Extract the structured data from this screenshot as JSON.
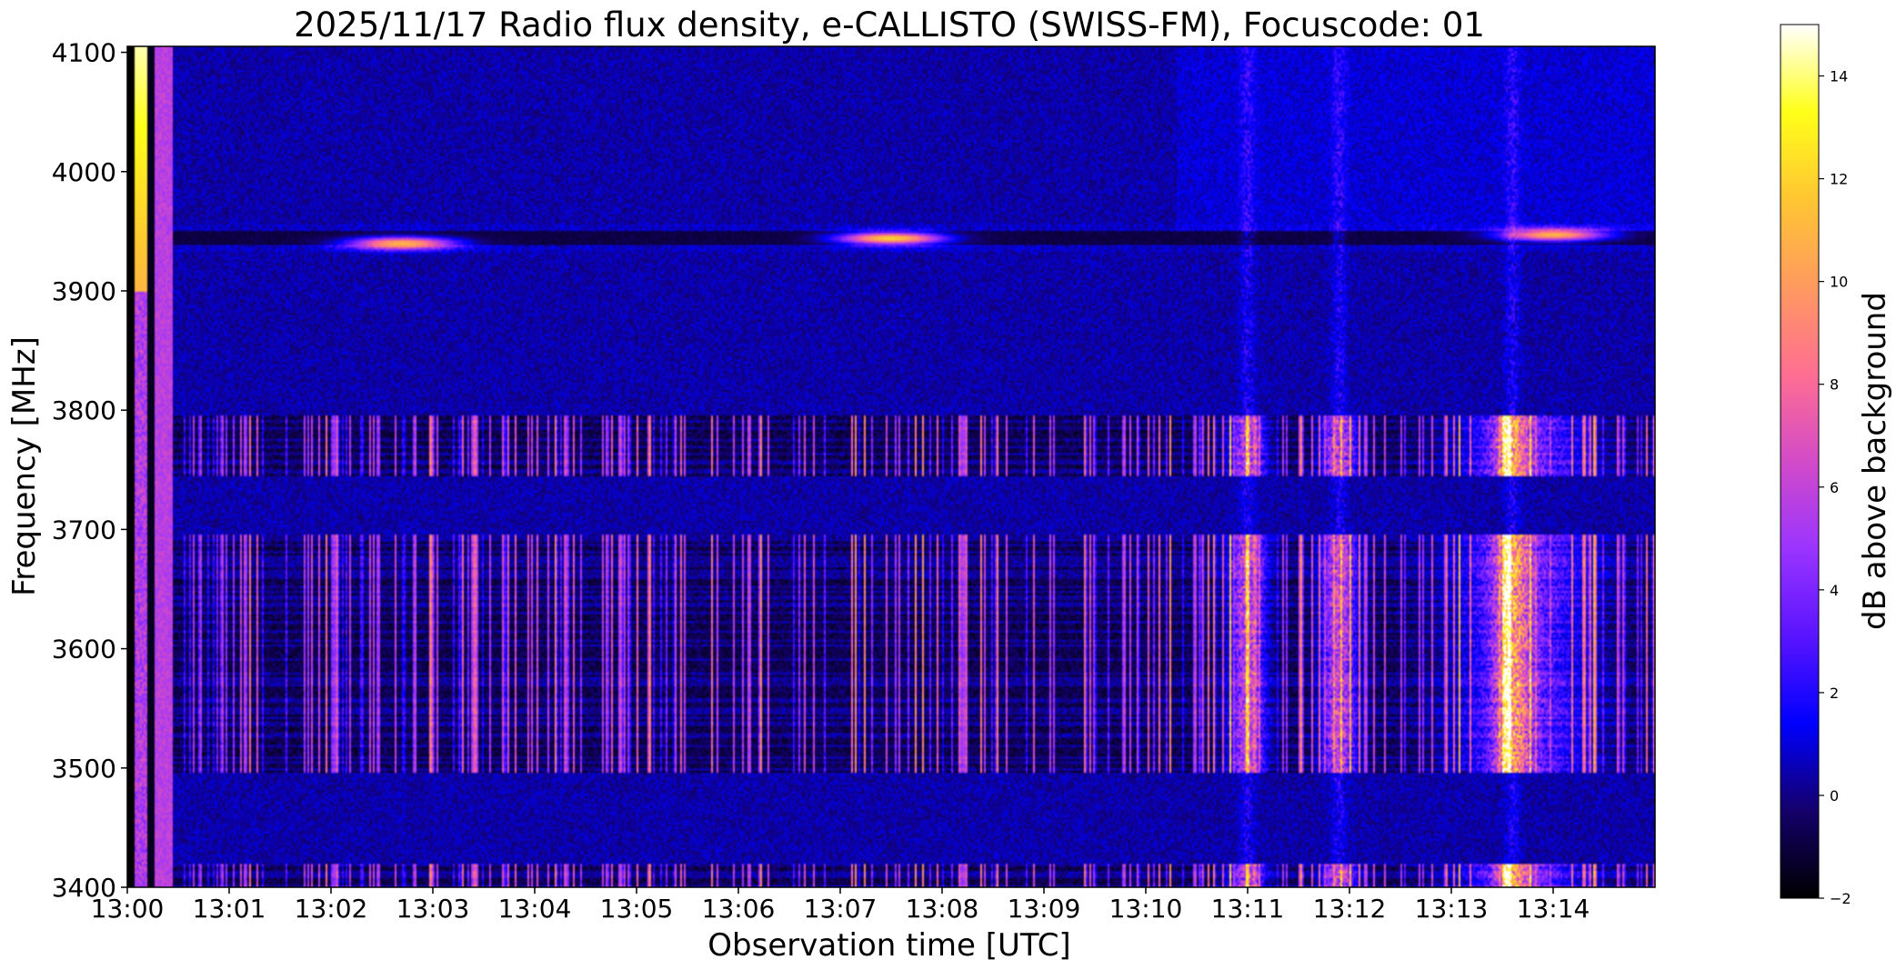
{
  "chart_data": {
    "type": "heatmap",
    "title": "2025/11/17  Radio flux density, e-CALLISTO (SWISS-FM), Focuscode: 01",
    "xlabel": "Observation time [UTC]",
    "ylabel": "Frequency [MHz]",
    "colorbar_label": "dB above background",
    "x_ticks": [
      "13:00",
      "13:01",
      "13:02",
      "13:03",
      "13:04",
      "13:05",
      "13:06",
      "13:07",
      "13:08",
      "13:09",
      "13:10",
      "13:11",
      "13:12",
      "13:13",
      "13:14"
    ],
    "xlim_minutes_after_1300": [
      0,
      15
    ],
    "ylim": [
      3400,
      4105
    ],
    "y_ticks": [
      3400,
      3500,
      3600,
      3700,
      3800,
      3900,
      4000,
      4100
    ],
    "colorbar_ticks": [
      -2,
      0,
      2,
      4,
      6,
      8,
      10,
      12,
      14
    ],
    "colorbar_range": [
      -2,
      15
    ],
    "colormap": "gnuplot2",
    "colormap_stops": [
      "#000000",
      "#14006a",
      "#0000ff",
      "#5a14ff",
      "#9a34ff",
      "#d24bc8",
      "#ff6e91",
      "#ff9a5f",
      "#ffc632",
      "#ffff19",
      "#ffffff"
    ],
    "features": {
      "background_level_db": 0.4,
      "horizontal_line_mhz": 3945,
      "bright_spots": [
        {
          "minute": 2.7,
          "freq_mhz": 3940,
          "db": 12
        },
        {
          "minute": 7.5,
          "freq_mhz": 3944,
          "db": 13
        },
        {
          "minute": 14.0,
          "freq_mhz": 3947,
          "db": 12
        }
      ],
      "rfi_bands_mhz": [
        [
          3745,
          3795
        ],
        [
          3495,
          3695
        ],
        [
          3400,
          3420
        ]
      ],
      "burst_minutes": [
        11.0,
        11.9,
        13.6
      ]
    }
  }
}
